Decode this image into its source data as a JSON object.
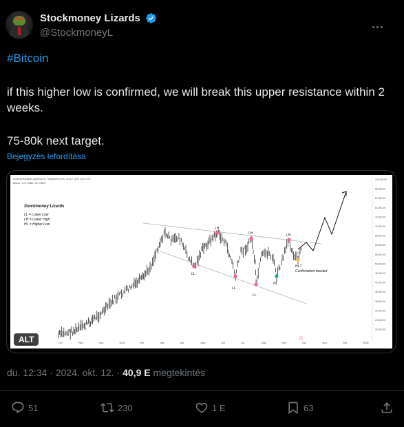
{
  "author": {
    "name": "Stockmoney Lizards",
    "handle": "@StockmoneyL"
  },
  "post": {
    "hashtag": "#Bitcoin",
    "paragraph1": "if this higher low is confirmed, we will break this upper resistance within 2 weeks.",
    "paragraph2": "75-80k next target.",
    "translate_label": "Bejegyzés lefordítása"
  },
  "media": {
    "alt_badge": "ALT",
    "chart_watermark": "Stockmoney Lizards",
    "chart_header": "stockmoneylizards published on TradingView.com, Oct 12, 2024 10:21 UTC",
    "chart_symbol": "Bitcoin / U.S. Dollar, 1D, INDEX",
    "legend": [
      "LL = Lower Low",
      "LH = Lower High",
      "HL = Higher Low"
    ],
    "labels": {
      "lh": "LH",
      "ll": "LL",
      "hl": "HL",
      "hl_q": "HL?",
      "confirm": "Confirmation needed"
    },
    "x_ticks": [
      "Oct",
      "Nov",
      "Dec",
      "2024",
      "Feb",
      "Mar",
      "Apr",
      "May",
      "Jun",
      "Jul",
      "Aug",
      "Sep",
      "Oct",
      "Nov",
      "Dec",
      "2025"
    ],
    "y_ticks": [
      "100,000.00",
      "95,000.00",
      "87,000.00",
      "81,000.00",
      "76,000.00",
      "70,000.00",
      "65,000.00",
      "60,000.00",
      "55,000.00",
      "50,000.00",
      "46,000.00",
      "42,000.00",
      "38,000.00",
      "35,000.00",
      "32,000.00",
      "29,000.00",
      "26,000.00"
    ],
    "tv_logo": "TradingView"
  },
  "meta": {
    "time": "du. 12:34",
    "dot1": "·",
    "date": "2024. okt. 12.",
    "dot2": "·",
    "views_count": "40,9 E",
    "views_label": "megtekintés"
  },
  "actions": {
    "replies": "51",
    "reposts": "230",
    "likes": "1 E",
    "bookmarks": "63"
  },
  "colors": {
    "accent": "#1d9bf0",
    "secondary_text": "#71767b",
    "divider": "#2f3336",
    "marker_pink": "#f06292",
    "marker_teal": "#26a69a",
    "marker_orange": "#ffb74d"
  }
}
